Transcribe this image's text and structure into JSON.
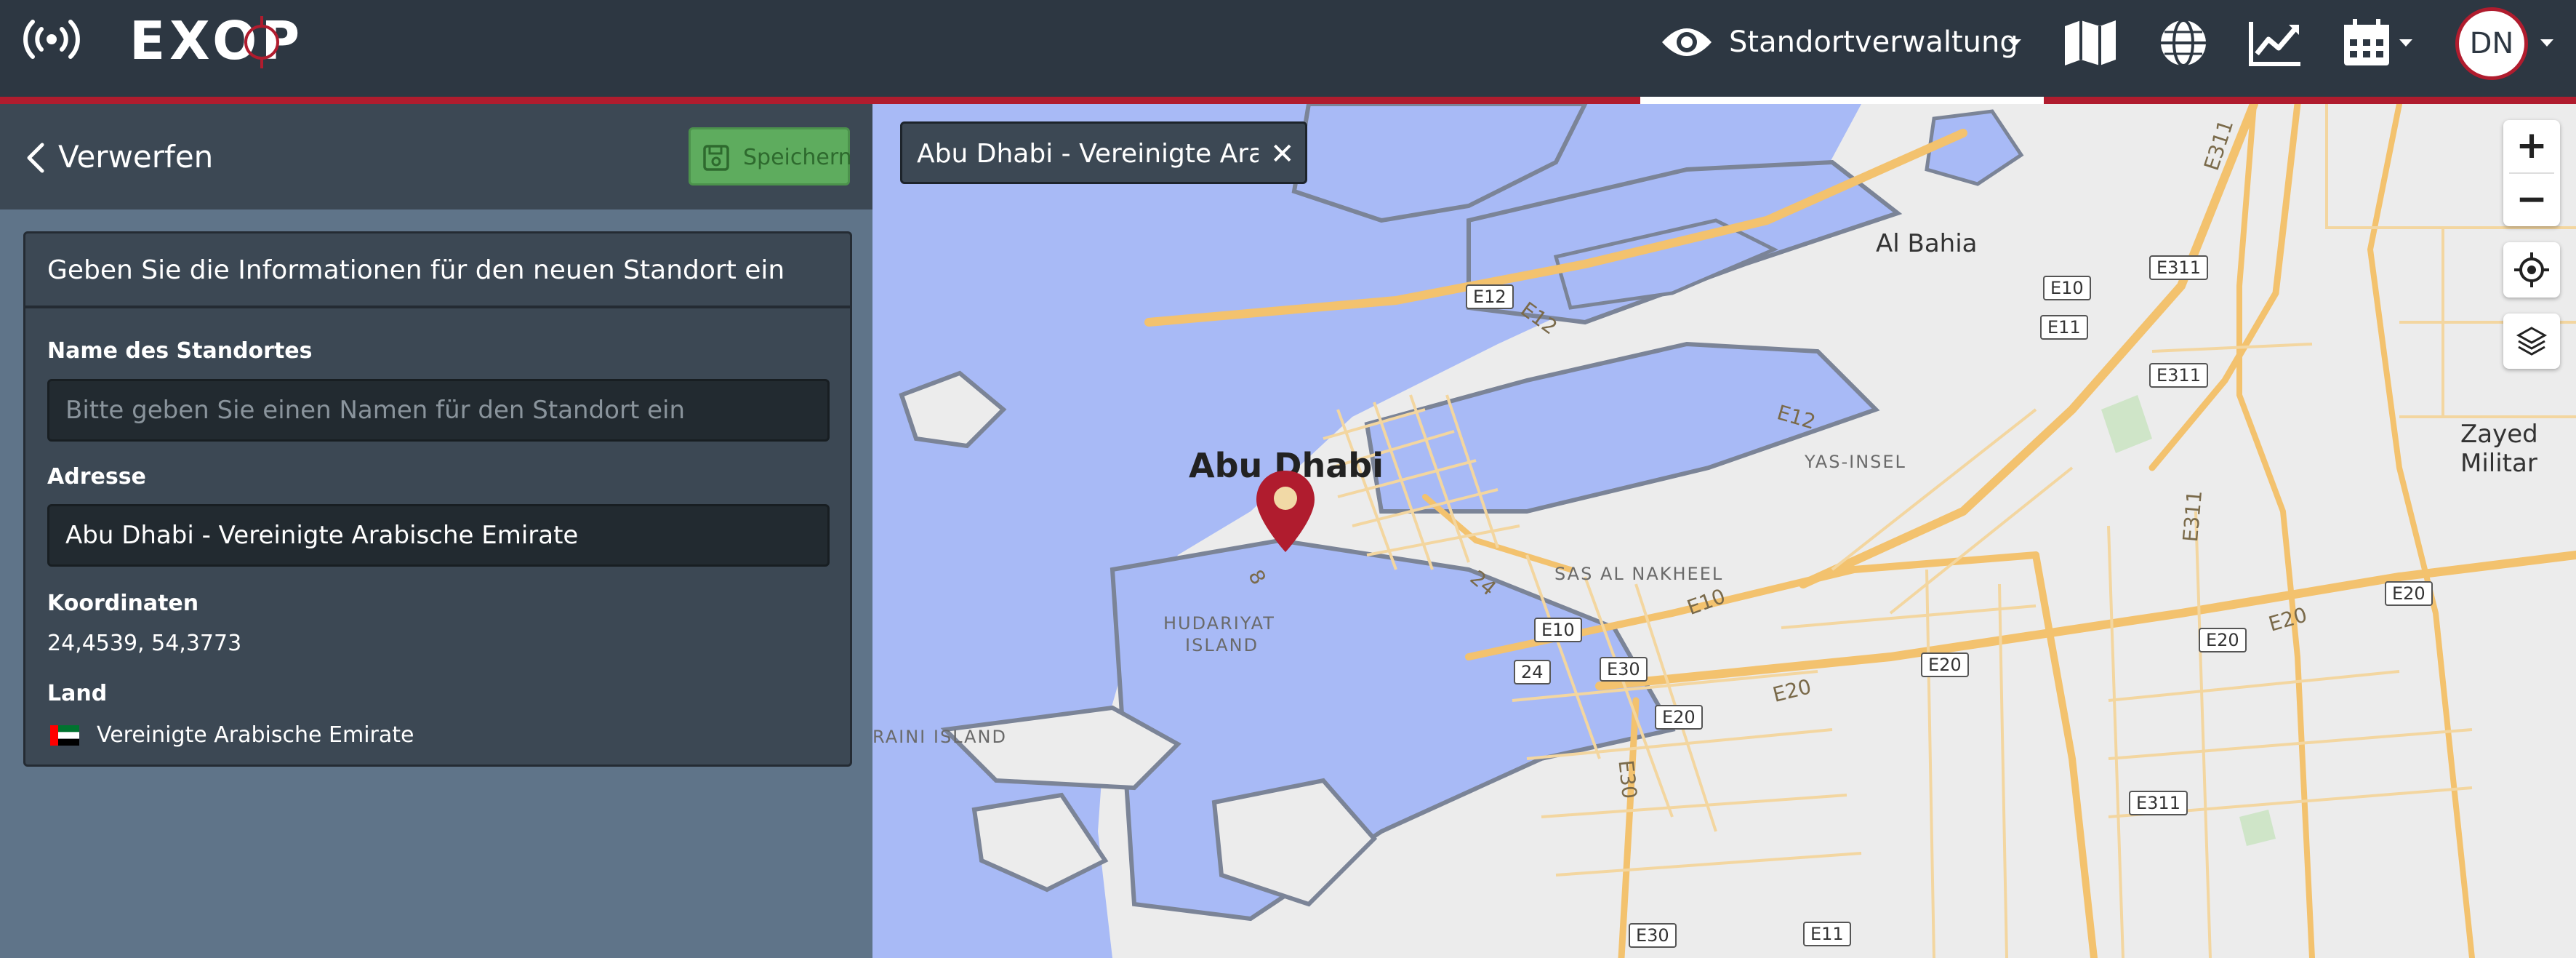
{
  "app": {
    "brand_text": "EXOP",
    "nav_label": "Standortverwaltung",
    "avatar_initials": "DN",
    "colors": {
      "topbar": "#2d3742",
      "accent_red": "#b01c2e",
      "panel": "#3c4854",
      "save_green": "#5eac5e"
    }
  },
  "topbar": {
    "icons": [
      "broadcast-icon",
      "eye-icon",
      "map-icon",
      "globe-icon",
      "chart-line-icon",
      "calendar-icon"
    ]
  },
  "panel": {
    "back_label": "Verwerfen",
    "save_label": "Speichern",
    "card_title": "Geben Sie die Informationen für den neuen Standort ein",
    "name_label": "Name des Standortes",
    "name_placeholder": "Bitte geben Sie einen Namen für den Standort ein",
    "name_value": "",
    "address_label": "Adresse",
    "address_value": "Abu Dhabi - Vereinigte Arabische Emirate",
    "coords_label": "Koordinaten",
    "coords_value": "24,4539, 54,3773",
    "country_label": "Land",
    "country_value": "Vereinigte Arabische Emirate"
  },
  "map": {
    "search_chip": "Abu Dhabi - Vereinigte Arabische Emirate",
    "chip_close": "✕",
    "zoom_in": "+",
    "zoom_out": "−",
    "labels": {
      "city": "Abu Dhabi",
      "al_bahia": "Al Bahia",
      "zayed": "Zayed Militar",
      "yas": "YAS-INSEL",
      "sas": "SAS AL NAKHEEL",
      "hudairiyat_1": "HUDARIYAT",
      "hudairiyat_2": "ISLAND",
      "rainy": "RAINI ISLAND"
    },
    "shields": {
      "e12": "E12",
      "e311a": "E311",
      "e10a": "E10",
      "e11a": "E11",
      "e311b": "E311",
      "e10b": "E10",
      "e24": "24",
      "e30a": "E30",
      "e20a": "E20",
      "e20b": "E20",
      "e20c": "E20",
      "e20d": "E20",
      "e311c": "E311",
      "e30b": "E30",
      "e11b": "E11"
    },
    "road_texts": {
      "e12a": "E12",
      "e12b": "E12",
      "e311v": "E311",
      "e311v2": "E311",
      "e10r": "E10",
      "e20r1": "E20",
      "e20r2": "E20",
      "e30r": "E30",
      "r24": "24",
      "r8": "8"
    }
  }
}
